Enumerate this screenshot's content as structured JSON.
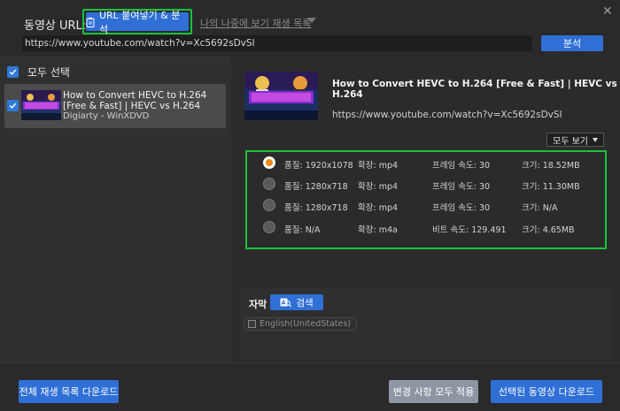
{
  "header": {
    "url_label": "동영상 URL:",
    "paste_button": "URL 붙여넣기 & 분석",
    "history_link": "나의 나중에 보기 재생 목록",
    "url_value": "https://www.youtube.com/watch?v=Xc5692sDvSI",
    "analyze_button": "분석"
  },
  "sidebar": {
    "select_all": "모두 선택",
    "items": [
      {
        "title": "How to Convert HEVC to H.264 [Free & Fast] | HEVC vs H.264",
        "channel": "Digiarty - WinXDVD",
        "checked": true
      }
    ]
  },
  "detail": {
    "title": "How to Convert HEVC to H.264 [Free & Fast] | HEVC vs H.264",
    "url": "https://www.youtube.com/watch?v=Xc5692sDvSI",
    "thumb_caption": "CONVERT HEVC TO H.264 FREE & FAST",
    "view_all": "모두 보기"
  },
  "formats": [
    {
      "quality": "품질: 1920x1078",
      "ext": "확장: mp4",
      "rate": "프레임 속도: 30",
      "size": "크기: 18.52MB",
      "selected": true
    },
    {
      "quality": "품질: 1280x718",
      "ext": "확장: mp4",
      "rate": "프레임 속도: 30",
      "size": "크기: 11.30MB",
      "selected": false
    },
    {
      "quality": "품질: 1280x718",
      "ext": "확장: mp4",
      "rate": "프레임 속도: 30",
      "size": "크기: N/A",
      "selected": false
    },
    {
      "quality": "품질: N/A",
      "ext": "확장: m4a",
      "rate": "비트 속도: 129.491",
      "size": "크기: 4.65MB",
      "selected": false
    }
  ],
  "subtitles": {
    "label": "자막",
    "search_button": "검색",
    "options": [
      "English(UnitedStates)"
    ]
  },
  "footer": {
    "download_playlist": "전체 재생 목록 다운로드",
    "apply_all": "변경 사항 모두 적용",
    "download_selected": "선택된 동영상 다운로드"
  },
  "colors": {
    "accent": "#2f6fd6",
    "highlight": "#19c23a",
    "radio_selected": "#f08a1a"
  }
}
